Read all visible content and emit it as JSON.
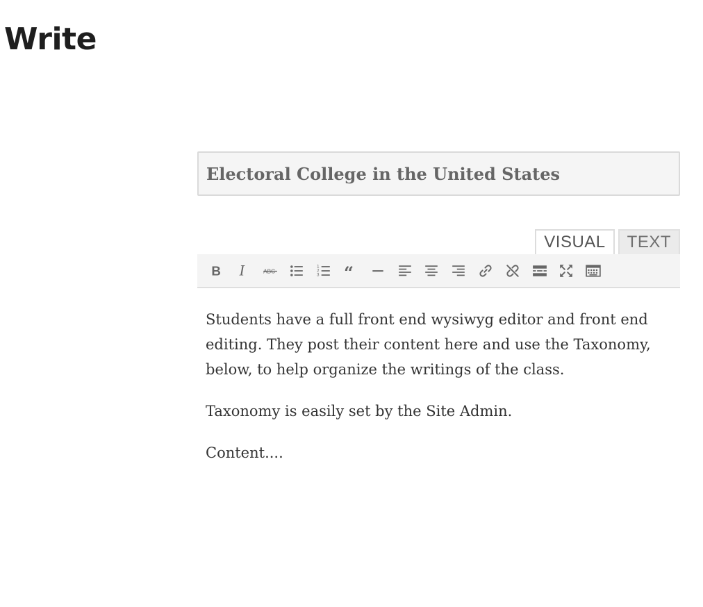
{
  "page": {
    "title": "Write"
  },
  "post": {
    "title_value": "Electoral College in the United States",
    "body": [
      "Students have a full front end wysiwyg editor and front end editing. They post their content here and use the Taxonomy, below, to help organize the writings of the class.",
      "Taxonomy is easily set by the Site Admin.",
      "Content...."
    ]
  },
  "editor": {
    "tabs": {
      "visual": "VISUAL",
      "text": "TEXT"
    },
    "active_tab": "VISUAL",
    "toolbar": [
      "bold-icon",
      "italic-icon",
      "strikethrough-icon",
      "bulleted-list-icon",
      "numbered-list-icon",
      "blockquote-icon",
      "horizontal-line-icon",
      "align-left-icon",
      "align-center-icon",
      "align-right-icon",
      "insert-link-icon",
      "remove-link-icon",
      "read-more-icon",
      "fullscreen-icon",
      "toolbar-toggle-icon"
    ]
  },
  "colors": {
    "toolbar_bg": "#f4f4f4",
    "title_bg": "#f5f5f5",
    "icon": "#666666",
    "text": "#333333"
  }
}
